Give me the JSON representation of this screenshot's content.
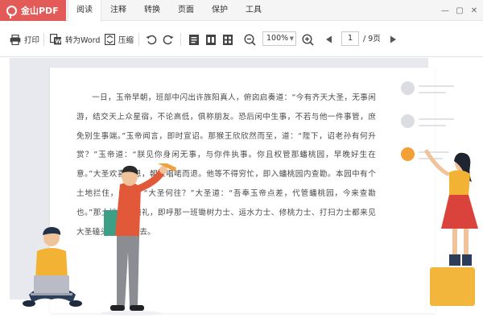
{
  "app": {
    "name": "金山PDF",
    "brand_color": "#e35b59"
  },
  "menu": {
    "items": [
      {
        "label": "阅读",
        "active": true
      },
      {
        "label": "注释",
        "active": false
      },
      {
        "label": "转换",
        "active": false
      },
      {
        "label": "页面",
        "active": false
      },
      {
        "label": "保护",
        "active": false
      },
      {
        "label": "工具",
        "active": false
      }
    ]
  },
  "window_controls": {
    "minimize": "—",
    "restore": "▢",
    "close": "✕"
  },
  "toolbar": {
    "print_label": "打印",
    "to_word_label": "转为Word",
    "compress_label": "压缩",
    "zoom_value": "100%",
    "page_current": "1",
    "page_total": "/ 9页"
  },
  "icons": [
    "logo-icon",
    "printer-icon",
    "to-word-icon",
    "compress-icon",
    "rotate-left-icon",
    "rotate-right-icon",
    "single-page-icon",
    "double-page-icon",
    "continuous-page-icon",
    "zoom-out-icon",
    "zoom-in-icon",
    "prev-page-icon",
    "next-page-icon"
  ],
  "document": {
    "text": "一日，玉帝早朝，班部中闪出许旌阳真人，俯囟启奏道：“今有齐天大圣，无事闲游，结交天上众星宿，不论高低，俱称朋友。恐后闲中生事，不若与他一件事管，庶免别生事端。”玉帝闻言，即时宣诏。那猴王欣欣然而至，道：“陛下，诏老孙有何升赏？”玉帝道：“朕见你身闲无事，与你件执事。你且权管那蟠桃园，早晚好生在意。”大圣欢喜谢恩，朝上唱喏而退。他等不得穷忙，即入蟠桃园内查勘。本园中有个土地拦住，问道：“大圣何往？”大圣道：“吾奉玉帝点差，代管蟠桃园，今来查勘也。”那土地连忙施礼，即呼那一班锄树力士、运水力士、修桃力士、打扫力士都来见大圣磕头，引他进去。"
  }
}
